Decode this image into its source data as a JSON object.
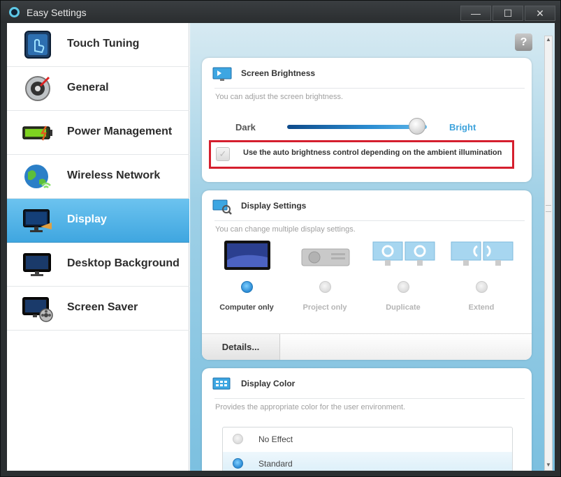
{
  "window": {
    "title": "Easy Settings",
    "controls": {
      "minimize": "—",
      "maximize": "☐",
      "close": "✕"
    }
  },
  "sidebar": {
    "items": [
      {
        "label": "Touch Tuning",
        "icon": "touch-tuning-icon"
      },
      {
        "label": "General",
        "icon": "general-icon"
      },
      {
        "label": "Power Management",
        "icon": "battery-icon"
      },
      {
        "label": "Wireless Network",
        "icon": "globe-wifi-icon"
      },
      {
        "label": "Display",
        "icon": "display-icon",
        "active": true
      },
      {
        "label": "Desktop Background",
        "icon": "desktop-background-icon"
      },
      {
        "label": "Screen Saver",
        "icon": "screen-saver-icon"
      }
    ]
  },
  "help": {
    "label": "?"
  },
  "brightness": {
    "title": "Screen Brightness",
    "description": "You can adjust the screen brightness.",
    "dark_label": "Dark",
    "bright_label": "Bright",
    "level": 0.93,
    "auto_label": "Use the auto brightness control depending on the ambient illumination",
    "auto_checked": true,
    "auto_enabled": false,
    "highlight_color": "#d51f2e"
  },
  "display_settings": {
    "title": "Display Settings",
    "description": "You can change multiple display settings.",
    "modes": [
      {
        "label": "Computer only",
        "selected": true
      },
      {
        "label": "Project only",
        "selected": false
      },
      {
        "label": "Duplicate",
        "selected": false
      },
      {
        "label": "Extend",
        "selected": false
      }
    ],
    "details_label": "Details..."
  },
  "display_color": {
    "title": "Display Color",
    "description": "Provides the appropriate color for the user environment.",
    "options": [
      {
        "label": "No Effect",
        "selected": false
      },
      {
        "label": "Standard",
        "selected": true
      }
    ]
  },
  "colors": {
    "accent": "#3fa6e0",
    "content_bg": "#9fd0e6"
  }
}
